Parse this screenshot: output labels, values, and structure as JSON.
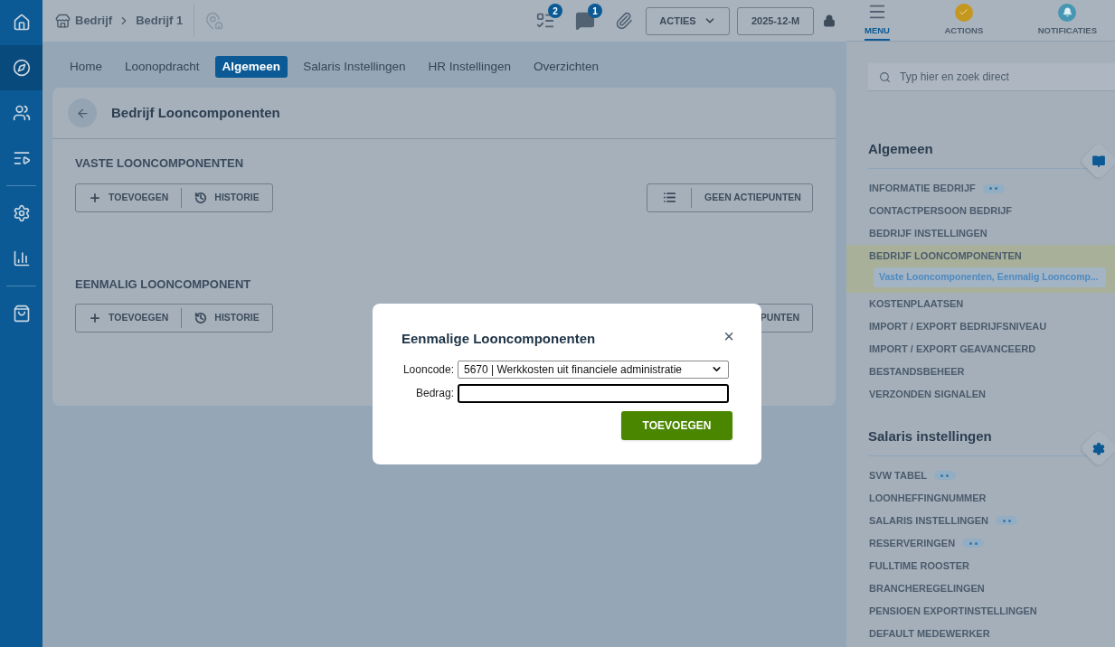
{
  "sidebar": {
    "items": [
      {
        "kind": "home",
        "selected": false
      },
      {
        "kind": "compass",
        "selected": true
      },
      {
        "kind": "users",
        "selected": false
      },
      {
        "kind": "playlist",
        "selected": false
      },
      {
        "kind": "gear",
        "selected": false
      },
      {
        "kind": "chart",
        "selected": false
      },
      {
        "kind": "bag",
        "selected": false
      }
    ]
  },
  "breadcrumb": [
    {
      "label": "Bedrijf"
    },
    {
      "label": "Bedrijf 1"
    }
  ],
  "toolbar": {
    "tasks_badge": "2",
    "messages_badge": "1",
    "actions_button": "ACTIES",
    "period_button": "2025-12-M"
  },
  "panel_tabs": [
    {
      "kind": "menu",
      "label": "MENU",
      "selected": true
    },
    {
      "kind": "actions",
      "label": "ACTIONS",
      "selected": false
    },
    {
      "kind": "notifications",
      "label": "NOTIFICATIES",
      "selected": false
    }
  ],
  "search": {
    "placeholder": "Typ hier en zoek direct"
  },
  "nav_tabs": [
    {
      "label": "Home",
      "selected": false
    },
    {
      "label": "Loonopdracht",
      "selected": false
    },
    {
      "label": "Algemeen",
      "selected": true
    },
    {
      "label": "Salaris Instellingen",
      "selected": false
    },
    {
      "label": "HR Instellingen",
      "selected": false
    },
    {
      "label": "Overzichten",
      "selected": false
    }
  ],
  "page": {
    "title": "Bedrijf Looncomponenten",
    "sections": [
      {
        "heading": "VASTE LOONCOMPONENTEN",
        "add_button": "TOEVOEGEN",
        "history_button": "HISTORIE",
        "status_button": "GEEN ACTIEPUNTEN",
        "covered": false
      },
      {
        "heading": "EENMALIG LOONCOMPONENT",
        "add_button": "TOEVOEGEN",
        "history_button": "HISTORIE",
        "status_button": "PUNTEN",
        "covered": true
      }
    ]
  },
  "dialog": {
    "title": "Eenmalige Looncomponenten",
    "close": "×",
    "fields": [
      {
        "kind": "select",
        "label": "Looncode:",
        "value": "5670 | Werkkosten uit financiele administratie",
        "focused": false
      },
      {
        "kind": "input",
        "label": "Bedrag:",
        "focused": true
      }
    ],
    "submit": "TOEVOEGEN"
  },
  "menu_sections": [
    {
      "title": "Algemeen",
      "kind": "book",
      "items": [
        {
          "label": "INFORMATIE BEDRIJF",
          "badge": true,
          "selected": false
        },
        {
          "label": "CONTACTPERSOON BEDRIJF",
          "badge": false,
          "selected": false
        },
        {
          "label": "BEDRIJF INSTELLINGEN",
          "badge": false,
          "selected": false
        },
        {
          "label": "BEDRIJF LOONCOMPONENTEN",
          "badge": false,
          "selected": true,
          "sub": "Vaste Looncomponenten, Eenmalig Looncomp..."
        },
        {
          "label": "KOSTENPLAATSEN",
          "badge": false,
          "selected": false
        },
        {
          "label": "IMPORT / EXPORT BEDRIJFSNIVEAU",
          "badge": false,
          "selected": false
        },
        {
          "label": "IMPORT / EXPORT GEAVANCEERD",
          "badge": false,
          "selected": false
        },
        {
          "label": "BESTANDSBEHEER",
          "badge": false,
          "selected": false
        },
        {
          "label": "VERZONDEN SIGNALEN",
          "badge": false,
          "selected": false
        }
      ]
    },
    {
      "title": "Salaris instellingen",
      "kind": "gear",
      "items": [
        {
          "label": "SVW TABEL",
          "badge": true,
          "selected": false
        },
        {
          "label": "LOONHEFFINGNUMMER",
          "badge": false,
          "selected": false
        },
        {
          "label": "SALARIS INSTELLINGEN",
          "badge": true,
          "selected": false
        },
        {
          "label": "RESERVERINGEN",
          "badge": true,
          "selected": false
        },
        {
          "label": "FULLTIME ROOSTER",
          "badge": false,
          "selected": false
        },
        {
          "label": "BRANCHEREGELINGEN",
          "badge": false,
          "selected": false
        },
        {
          "label": "PENSIOEN EXPORTINSTELLINGEN",
          "badge": false,
          "selected": false
        },
        {
          "label": "DEFAULT MEDEWERKER",
          "badge": false,
          "selected": false
        }
      ]
    }
  ]
}
